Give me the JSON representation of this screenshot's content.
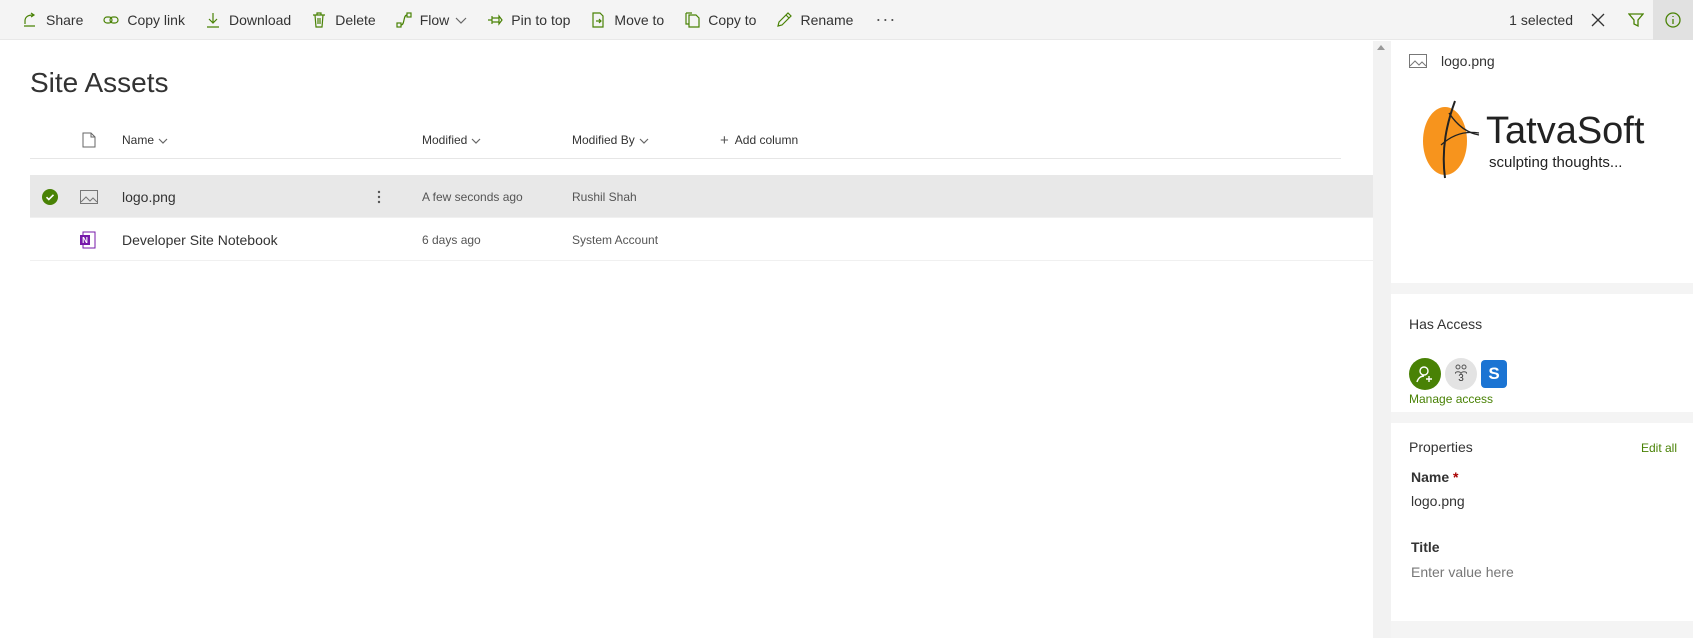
{
  "commandbar": {
    "items": [
      {
        "label": "Share",
        "icon": "share-icon"
      },
      {
        "label": "Copy link",
        "icon": "link-icon"
      },
      {
        "label": "Download",
        "icon": "download-icon"
      },
      {
        "label": "Delete",
        "icon": "trash-icon"
      },
      {
        "label": "Flow",
        "icon": "flow-icon"
      },
      {
        "label": "Pin to top",
        "icon": "pin-icon"
      },
      {
        "label": "Move to",
        "icon": "move-icon"
      },
      {
        "label": "Copy to",
        "icon": "copy-icon"
      },
      {
        "label": "Rename",
        "icon": "pencil-icon"
      }
    ],
    "more": "···",
    "selected": "1 selected"
  },
  "page": {
    "title": "Site Assets"
  },
  "list": {
    "headers": {
      "name": "Name",
      "modified": "Modified",
      "modified_by": "Modified By",
      "add_column": "Add column"
    },
    "rows": [
      {
        "name": "logo.png",
        "modified": "A few seconds ago",
        "modified_by": "Rushil Shah",
        "selected": true,
        "icon": "image-file-icon"
      },
      {
        "name": "Developer Site Notebook",
        "modified": "6 days ago",
        "modified_by": "System Account",
        "selected": false,
        "icon": "onenote-icon"
      }
    ]
  },
  "details": {
    "file_name": "logo.png",
    "logo": {
      "name": "TatvaSoft",
      "tagline": "sculpting thoughts..."
    },
    "access": {
      "title": "Has Access",
      "group_count": "3",
      "manage_label": "Manage access"
    },
    "properties": {
      "title": "Properties",
      "edit_all": "Edit all",
      "name_label": "Name",
      "required_mark": "*",
      "name_value": "logo.png",
      "title_label": "Title",
      "title_placeholder": "Enter value here"
    }
  },
  "colors": {
    "accent": "#498205",
    "selected_row": "#e8e8e8",
    "sharepoint_blue": "#1b74d3"
  }
}
